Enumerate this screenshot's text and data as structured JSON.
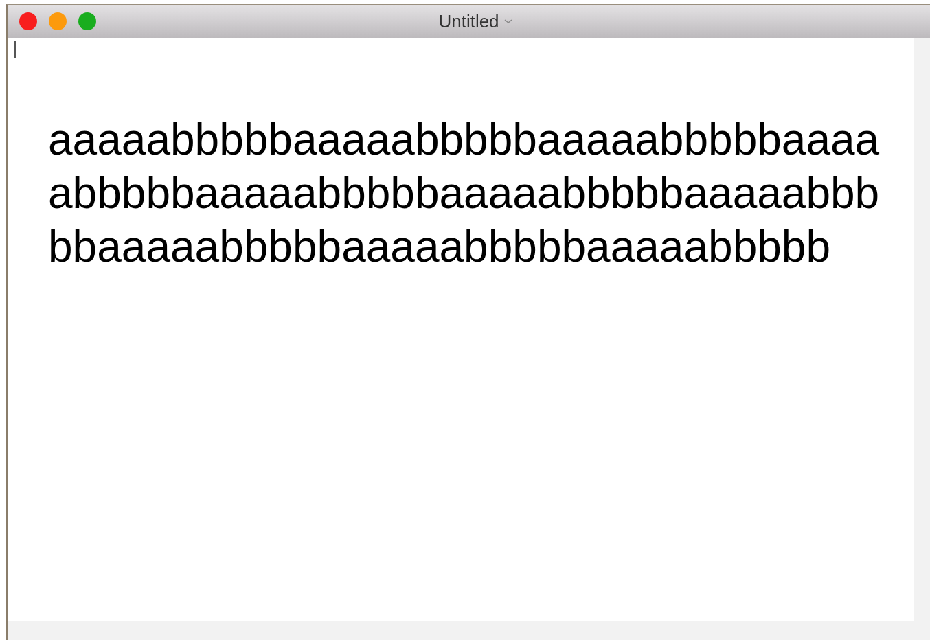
{
  "window": {
    "title": "Untitled"
  },
  "document": {
    "lines": [
      "aaaaabbbbbaaaaabbbbbaaaaabbbbbaaaa",
      "abbbbbaaaaabbbbbaaaaabbbbbaaaaabbb",
      "bbaaaaabbbbbaaaaabbbbbaaaaabbbbb"
    ]
  }
}
